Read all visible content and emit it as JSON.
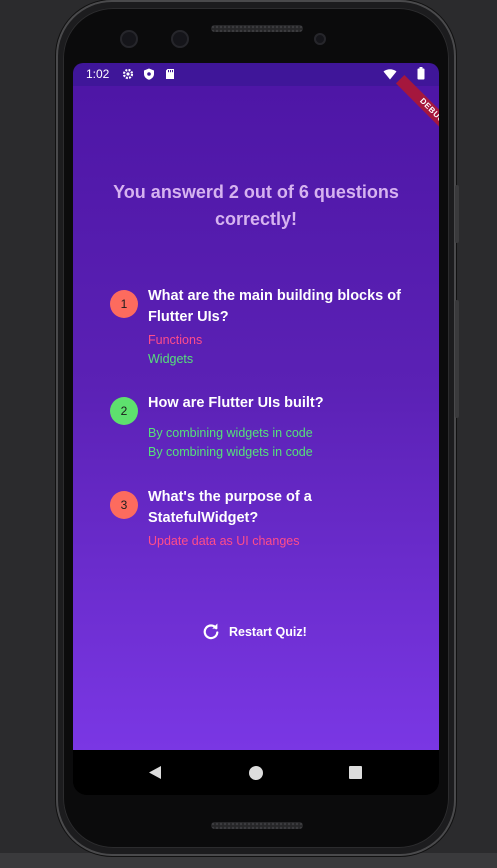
{
  "status_bar": {
    "time": "1:02",
    "left_icons": [
      "gear-icon",
      "shield-icon",
      "sd-card-icon"
    ],
    "right_icons": [
      "wifi-icon",
      "battery-icon"
    ]
  },
  "debug_banner": "DEBUG",
  "summary_text": "You answerd 2 out of 6 questions correctly!",
  "questions": [
    {
      "index": "1",
      "question": "What are the main building blocks of Flutter UIs?",
      "user_answer": "Functions",
      "correct_answer": "Widgets",
      "is_correct": false
    },
    {
      "index": "2",
      "question": "How are Flutter UIs built?",
      "user_answer": "By combining widgets in code",
      "correct_answer": "By combining widgets in code",
      "is_correct": true
    },
    {
      "index": "3",
      "question": "What's the purpose of a StatefulWidget?",
      "user_answer": "Update data as UI changes",
      "correct_answer": "",
      "is_correct": false
    }
  ],
  "restart_button": {
    "label": "Restart Quiz!",
    "icon": "refresh-icon"
  },
  "nav_bar": {
    "icons": [
      "back-icon",
      "home-icon",
      "recents-icon"
    ]
  },
  "colors": {
    "correct": "#5ee06e",
    "incorrect": "#fd6b5e",
    "wrong_answer_text": "#ff4d8a",
    "correct_answer_text": "#56e07a",
    "summary_text": "#d6b3f0",
    "gradient_top": "#4e16a6",
    "gradient_bottom": "#7a37e4"
  }
}
